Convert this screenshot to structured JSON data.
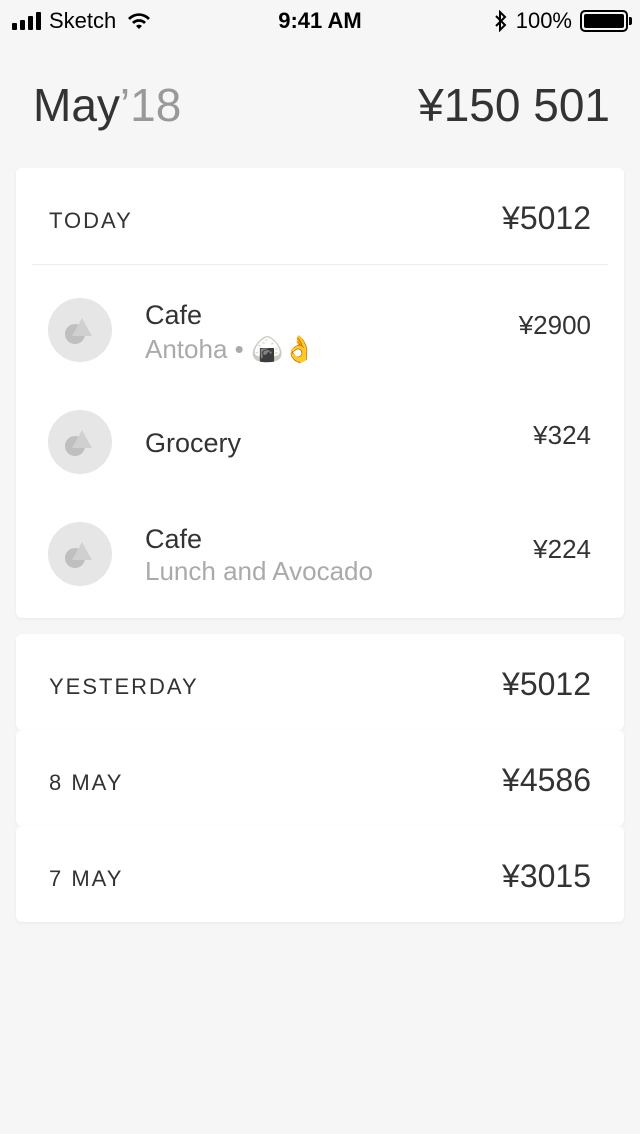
{
  "status_bar": {
    "carrier": "Sketch",
    "time": "9:41 AM",
    "battery": "100%"
  },
  "header": {
    "month": "May",
    "year": "’18",
    "total": "¥150 501"
  },
  "days": [
    {
      "label": "TODAY",
      "total": "¥5012",
      "transactions": [
        {
          "title": "Cafe",
          "subtitle": "Antoha • 🍙👌",
          "amount": "¥2900",
          "icon": "category-icon"
        },
        {
          "title": "Grocery",
          "subtitle": "",
          "amount": "¥324",
          "icon": "category-icon"
        },
        {
          "title": "Cafe",
          "subtitle": "Lunch and Avocado",
          "amount": "¥224",
          "icon": "category-icon"
        }
      ]
    },
    {
      "label": "YESTERDAY",
      "total": "¥5012"
    },
    {
      "label": "8 MAY",
      "total": "¥4586"
    },
    {
      "label": "7 MAY",
      "total": "¥3015"
    }
  ]
}
